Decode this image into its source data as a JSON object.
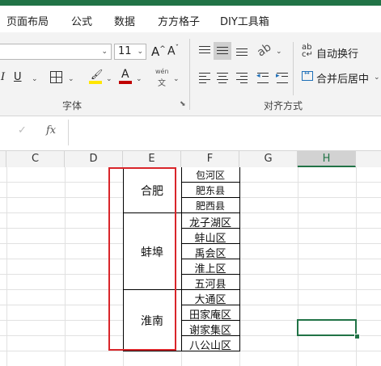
{
  "menu": [
    "页面布局",
    "公式",
    "数据",
    "方方格子",
    "DIY工具箱"
  ],
  "font_group": {
    "font_size": "11",
    "grow_font": "A",
    "shrink_font": "A",
    "italic": "I",
    "underline": "U",
    "font_color_letter": "A",
    "phonetic_top": "wén",
    "phonetic_bottom": "文",
    "label": "字体"
  },
  "alignment_group": {
    "wrap_text": "自动换行",
    "merge_center": "合并后居中",
    "label": "对齐方式"
  },
  "formula_bar": {
    "cancel": "✓",
    "fx": "fx",
    "value": ""
  },
  "columns": [
    "C",
    "D",
    "E",
    "F",
    "G",
    "H"
  ],
  "merged_cells": [
    "合肥",
    "蚌埠",
    "淮南"
  ],
  "districts": [
    "包河区",
    "肥东县",
    "肥西县",
    "龙子湖区",
    "蚌山区",
    "禹会区",
    "淮上区",
    "五河县",
    "大通区",
    "田家庵区",
    "谢家集区",
    "八公山区"
  ],
  "colors": {
    "excel_green": "#217346",
    "highlight_red": "#d9252a",
    "fill_yellow": "#ffe600",
    "font_red": "#c00000"
  }
}
